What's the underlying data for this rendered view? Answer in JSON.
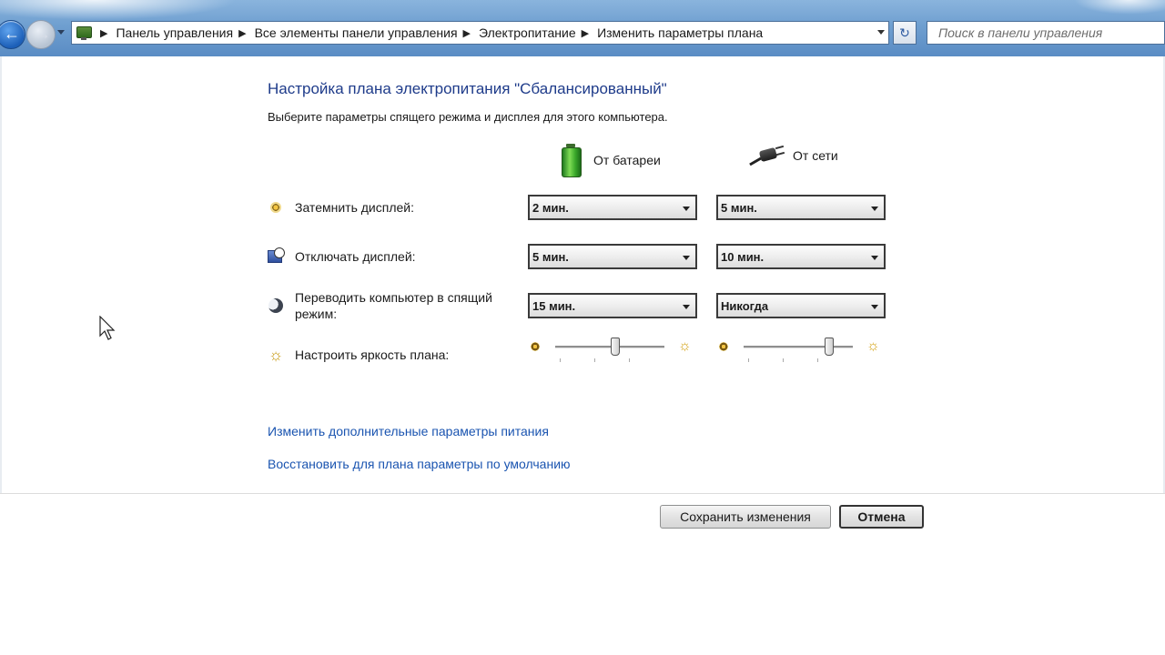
{
  "address_bar": {
    "breadcrumbs": [
      "Панель управления",
      "Все элементы панели управления",
      "Электропитание",
      "Изменить параметры плана"
    ],
    "search_placeholder": "Поиск в панели управления"
  },
  "page": {
    "title": "Настройка плана электропитания \"Сбалансированный\"",
    "subtitle": "Выберите параметры спящего режима и дисплея для этого компьютера."
  },
  "columns": {
    "battery": "От батареи",
    "plugged_in": "От сети"
  },
  "settings": {
    "dim_display": {
      "label": "Затемнить дисплей:",
      "battery": "2 мин.",
      "plugged_in": "5 мин."
    },
    "turn_off_display": {
      "label": "Отключать дисплей:",
      "battery": "5 мин.",
      "plugged_in": "10 мин."
    },
    "sleep": {
      "label_line1": "Переводить компьютер в спящий",
      "label_line2": "режим:",
      "battery": "15 мин.",
      "plugged_in": "Никогда"
    },
    "brightness": {
      "label": "Настроить яркость плана:",
      "battery_level": 0.55,
      "plugged_in_level": 0.78
    }
  },
  "links": {
    "advanced": "Изменить дополнительные параметры питания",
    "restore": "Восстановить для плана параметры по умолчанию"
  },
  "buttons": {
    "save": "Сохранить изменения",
    "cancel": "Отмена"
  },
  "icons": {
    "back": "back-arrow-icon",
    "forward": "forward-arrow-icon",
    "control_panel": "control-panel-icon",
    "refresh": "refresh-icon",
    "battery": "battery-icon",
    "plug": "power-plug-icon",
    "dim": "dim-display-icon",
    "turn_off": "display-off-icon",
    "sleep": "sleep-moon-icon",
    "brightness": "brightness-sun-icon"
  }
}
